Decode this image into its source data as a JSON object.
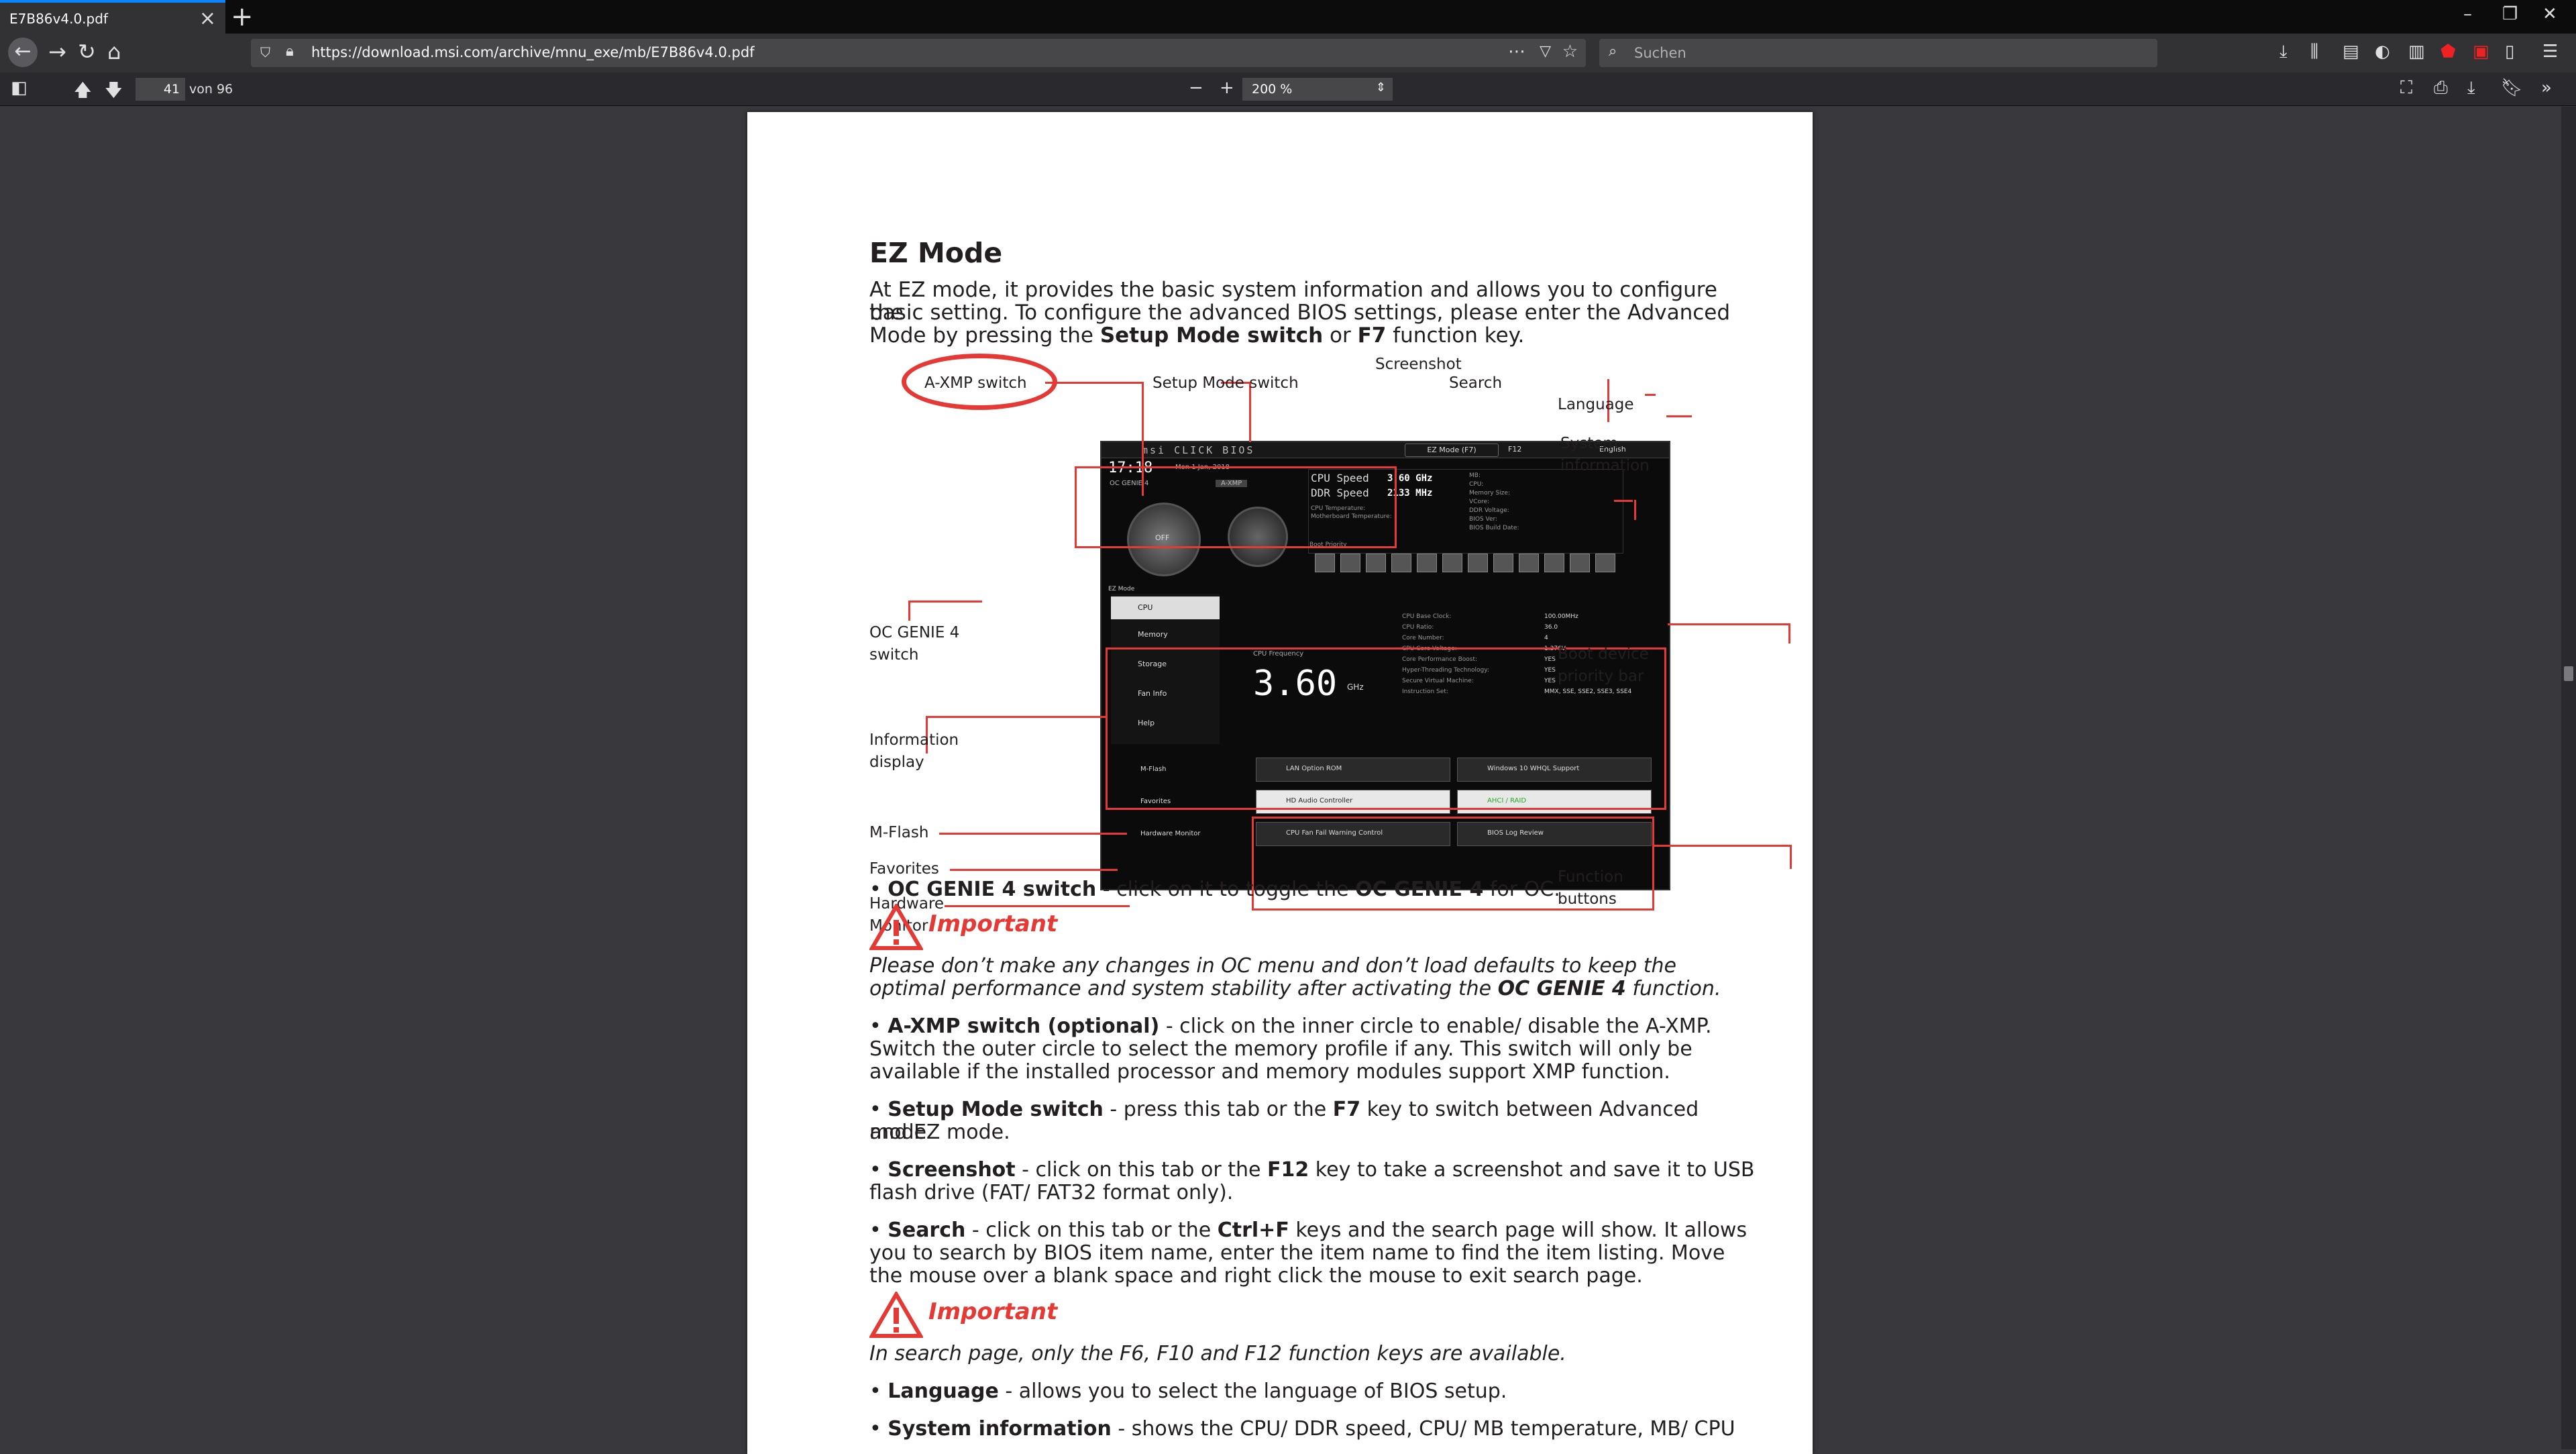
{
  "browser": {
    "tab_title": "E7B86v4.0.pdf",
    "url": "https://download.msi.com/archive/mnu_exe/mb/E7B86v4.0.pdf",
    "search_placeholder": "Suchen"
  },
  "pdf": {
    "page_number": "41",
    "page_of": "von 96",
    "zoom": "200 %"
  },
  "doc": {
    "heading": "EZ Mode",
    "intro_1": "At EZ mode, it provides the basic system information and allows you to configure the",
    "intro_2": "basic setting. To configure the advanced BIOS settings, please enter the Advanced",
    "intro_3a": "Mode by pressing the ",
    "intro_3b": "Setup Mode switch",
    "intro_3c": " or ",
    "intro_3d": "F7",
    "intro_3e": " function key.",
    "figure": {
      "a_xmp": "A-XMP switch",
      "setup_mode": "Setup Mode switch",
      "screenshot": "Screenshot",
      "search": "Search",
      "language": "Language",
      "system_info_1": "System",
      "system_info_2": "information",
      "oc_genie_1": "OC GENIE 4",
      "oc_genie_2": "switch",
      "boot_1": "Boot device",
      "boot_2": "priority bar",
      "info_1": "Information",
      "info_2": "display",
      "mflash": "M-Flash",
      "favorites": "Favorites",
      "hw_1": "Hardware",
      "hw_2": "Monitor",
      "fn_1": "Function",
      "fn_2": "buttons",
      "bios": {
        "brand": "msi CLICK BIOS",
        "ezmode": "EZ Mode (F7)",
        "f12": "F12",
        "lang": "English",
        "clock": "17:18",
        "date": "Mon 1 Jan, 2018",
        "oc_genie": "OC GENIE 4",
        "axmp": "A-XMP",
        "off": "OFF",
        "cpu_speed_label": "CPU Speed",
        "cpu_speed": "3.60 GHz",
        "ddr_speed_label": "DDR Speed",
        "ddr_speed": "2133 MHz",
        "cpu_temp": "CPU Temperature:",
        "mb_temp": "Motherboard Temperature:",
        "mb": "MB:",
        "cpu": "CPU:",
        "mem_size": "Memory Size:",
        "vcore": "VCore:",
        "ddr_voltage": "DDR Voltage:",
        "bios_ver": "BIOS Ver:",
        "bios_date": "BIOS Build Date:",
        "boot_priority": "Boot Priority",
        "ez_mode_tab": "EZ Mode",
        "menu": [
          "CPU",
          "Memory",
          "Storage",
          "Fan Info",
          "Help"
        ],
        "cpu_freq_label": "CPU Frequency",
        "cpu_freq": "3.60",
        "ghz": "GHz",
        "spec_labels": [
          "CPU Base Clock:",
          "CPU Ratio:",
          "Core Number:",
          "CPU Core Voltage:",
          "Core Performance Boost:",
          "Hyper-Threading Technology:",
          "Secure Virtual Machine:",
          "Instruction Set:"
        ],
        "spec_values": [
          "100.00MHz",
          "36.0",
          "4",
          "1.376V",
          "YES",
          "YES",
          "YES",
          "MMX, SSE, SSE2, SSE3, SSE4"
        ],
        "left_btns": [
          "M-Flash",
          "Favorites",
          "Hardware Monitor"
        ],
        "fn_btns": [
          "LAN Option ROM",
          "Windows 10 WHQL Support",
          "HD Audio Controller",
          "AHCI / RAID",
          "CPU Fan Fail Warning Control",
          "BIOS Log Review"
        ]
      }
    },
    "b1_label": "OC GENIE 4 switch",
    "b1_text": " - click on it to toggle the ",
    "b1_bold": "OC GENIE 4",
    "b1_end": " for OC.",
    "important": "Important",
    "imp1_a": "Please don’t make any changes in OC menu and don’t load defaults to keep the",
    "imp1_b": "optimal performance and system stability after activating the ",
    "imp1_bold": "OC GENIE 4",
    "imp1_end": " function.",
    "b2_label": "A-XMP switch (optional)",
    "b2_1": " - click on the inner circle to enable/ disable the A-XMP.",
    "b2_2": "Switch the outer circle to select the memory profile if any. This switch will only be",
    "b2_3": "available if the installed processor and memory modules support XMP function.",
    "b3_label": "Setup Mode switch",
    "b3_1": " - press this tab or the ",
    "b3_bold": "F7",
    "b3_2": " key to switch between Advanced mode",
    "b3_3": "and EZ mode.",
    "b4_label": "Screenshot",
    "b4_1": " - click on this tab or the ",
    "b4_bold": "F12",
    "b4_2": " key to take a screenshot and save it to USB",
    "b4_3": "flash drive (FAT/ FAT32 format only).",
    "b5_label": "Search",
    "b5_1": " - click on this tab or the ",
    "b5_bold": "Ctrl+F",
    "b5_2": " keys and the search page will show. It allows",
    "b5_3": "you to search by BIOS item name, enter the item name to find the item listing. Move",
    "b5_4": "the mouse over a blank space and right click the mouse to exit search page.",
    "imp2": "In search page, only the F6, F10 and F12 function keys are available.",
    "b6_label": "Language",
    "b6_text": " - allows you to select the language of BIOS setup.",
    "b7_label": "System information",
    "b7_text": " - shows the CPU/ DDR speed, CPU/ MB temperature, MB/ CPU"
  },
  "colors": {
    "accent": "#0a84ff",
    "callout_red": "#e53935",
    "page_bg": "#ffffff",
    "viewer_bg": "#38383d"
  }
}
